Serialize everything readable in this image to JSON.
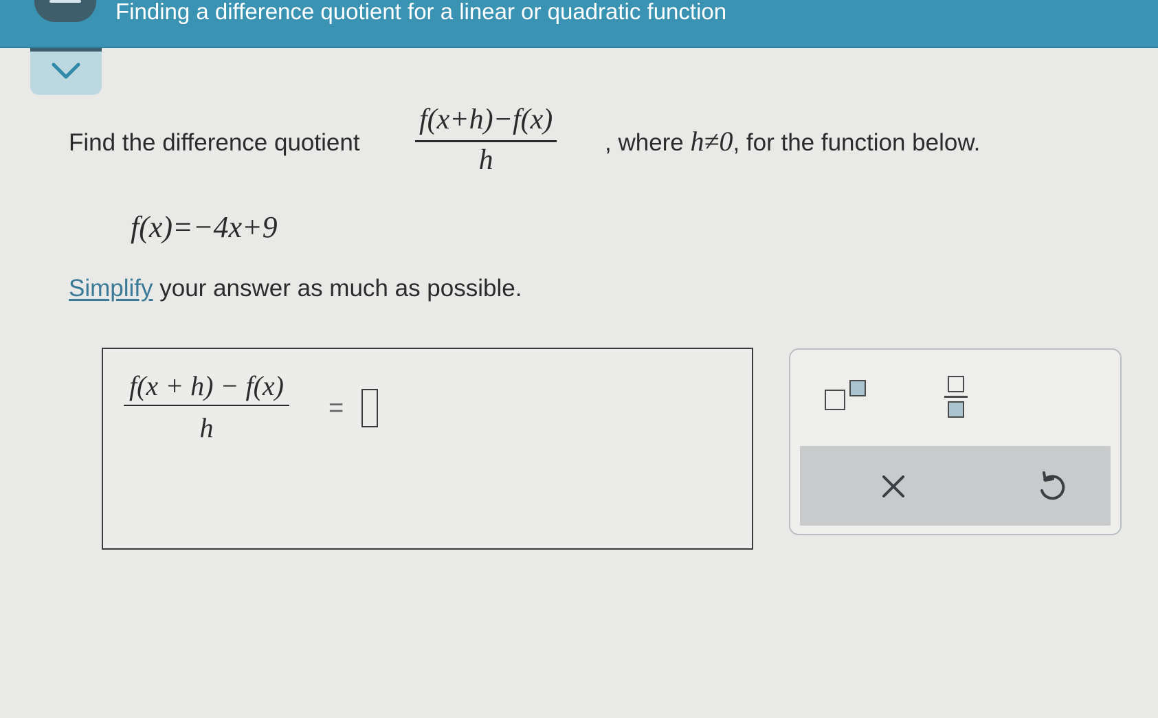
{
  "header": {
    "title": "Finding a difference quotient for a linear or quadratic function"
  },
  "question": {
    "intro": "Find the difference quotient",
    "quotient_numerator": "f(x+h)−f(x)",
    "quotient_denominator": "h",
    "tail_where": ", where ",
    "condition": "h≠0",
    "tail_rest": ", for the function below.",
    "function_definition": "f(x)=−4x+9",
    "simplify_link": "Simplify",
    "simplify_rest": " your answer as much as possible."
  },
  "answer": {
    "numerator": "f(x + h) − f(x)",
    "denominator": "h",
    "equals": "=",
    "value": ""
  },
  "tools": {
    "exponent_icon": "exponent-template-icon",
    "fraction_icon": "fraction-template-icon",
    "clear_symbol": "×",
    "undo_icon": "undo-icon"
  },
  "colors": {
    "header_bg": "#3a93b3",
    "link": "#3a7a97",
    "page_bg": "#e9e9e7"
  }
}
